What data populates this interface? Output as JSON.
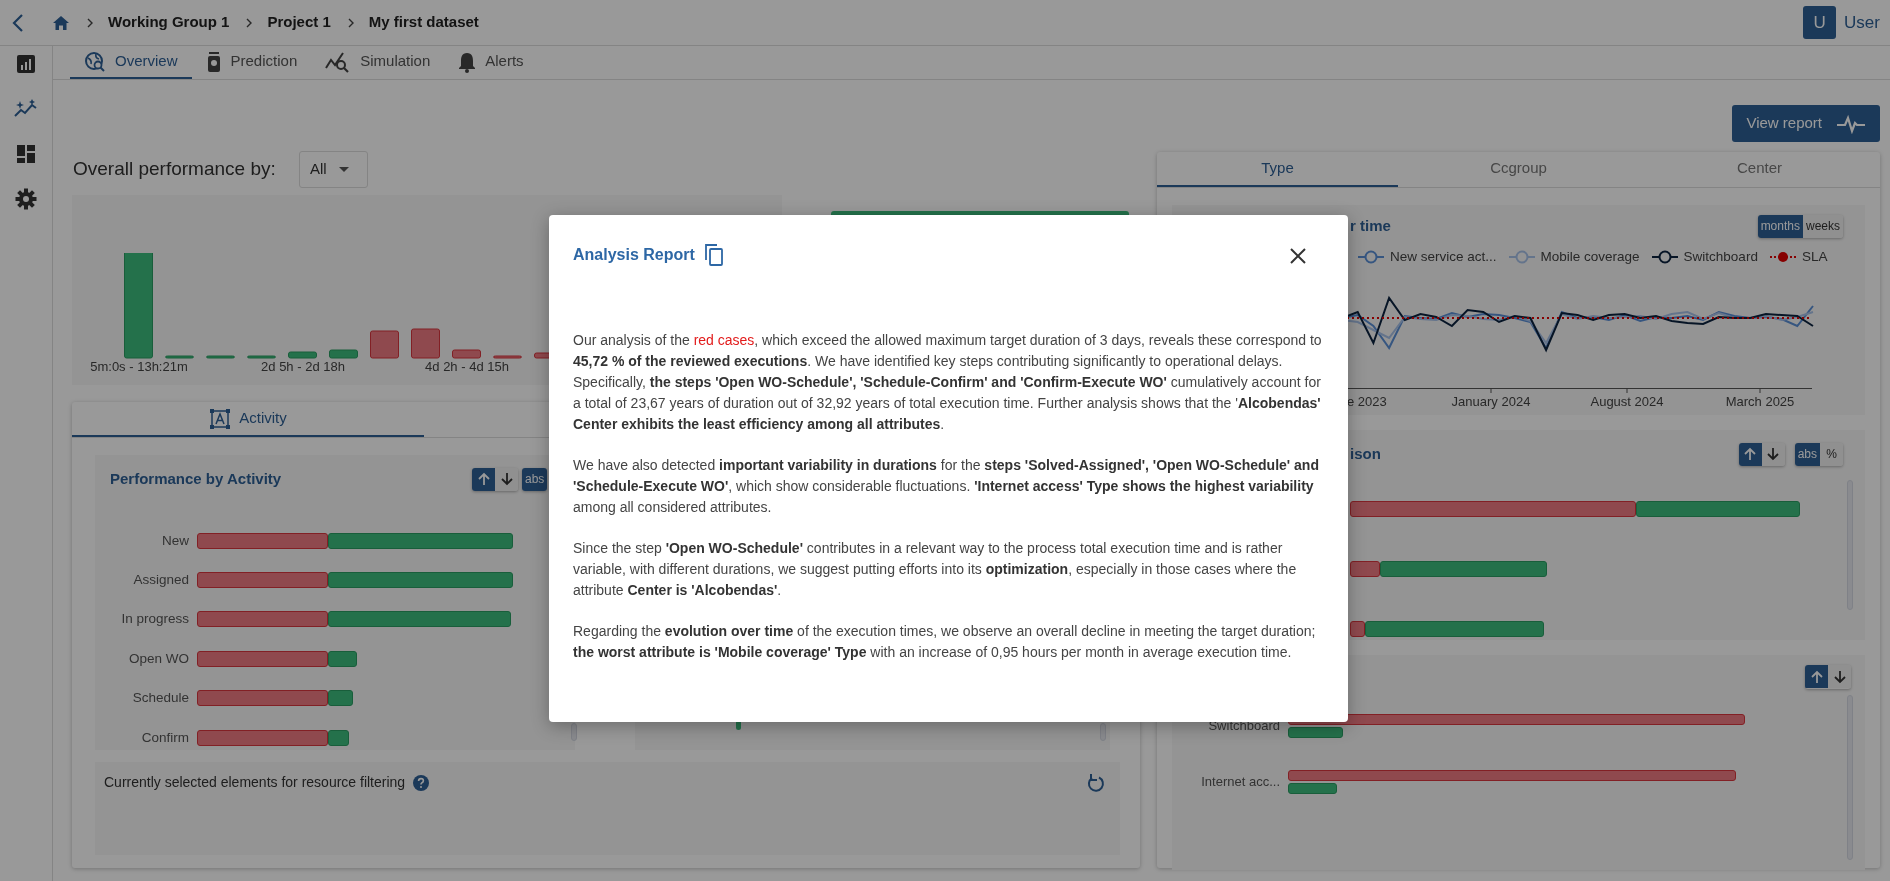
{
  "breadcrumbs": [
    "Working Group 1",
    "Project 1",
    "My first dataset"
  ],
  "user": {
    "initial": "U",
    "name": "User"
  },
  "tabs": [
    {
      "label": "Overview",
      "selected": true
    },
    {
      "label": "Prediction",
      "selected": false
    },
    {
      "label": "Simulation",
      "selected": false
    },
    {
      "label": "Alerts",
      "selected": false
    }
  ],
  "view_report_button": "View report",
  "performance": {
    "label": "Overall performance by:",
    "dropdown": "All"
  },
  "histogram": {
    "x_labels": [
      "5m:0s - 13h:21m",
      "2d 5h - 2d 18h",
      "4d 2h - 4d 15h"
    ]
  },
  "activity_card": {
    "tabs": [
      {
        "label": "Activity",
        "selected": true
      }
    ],
    "panel": {
      "title": "Performance by Activity",
      "sort": [
        {
          "selected": true
        },
        {
          "selected": false
        }
      ],
      "modes": [
        {
          "label": "abs",
          "selected": true
        }
      ],
      "rows": [
        "New",
        "Assigned",
        "In progress",
        "Open WO",
        "Schedule",
        "Confirm"
      ]
    },
    "filter": {
      "label": "Currently selected elements for resource filtering"
    }
  },
  "attribute_card": {
    "tabs": [
      {
        "label": "Type",
        "selected": true
      },
      {
        "label": "Ccgroup",
        "selected": false
      },
      {
        "label": "Center",
        "selected": false
      }
    ],
    "over_time": {
      "title": "r time",
      "units": [
        {
          "label": "months",
          "selected": true
        },
        {
          "label": "weeks",
          "selected": false
        }
      ],
      "legend": [
        {
          "name": "New service act...",
          "kind": "line"
        },
        {
          "name": "Mobile coverage",
          "kind": "line"
        },
        {
          "name": "Switchboard",
          "kind": "line"
        },
        {
          "name": "SLA",
          "kind": "dotted"
        }
      ],
      "x_labels": [
        "e 2023",
        "January 2024",
        "August 2024",
        "March 2025"
      ]
    },
    "comparison": {
      "title": "ison",
      "sort": [
        {
          "selected": true
        },
        {
          "selected": false
        }
      ],
      "modes": [
        {
          "label": "abs",
          "selected": true
        },
        {
          "label": "%",
          "selected": false
        }
      ]
    },
    "breakdown": {
      "sort": [
        {
          "selected": true
        },
        {
          "selected": false
        }
      ],
      "rows": [
        "Switchboard",
        "Internet acc..."
      ]
    }
  },
  "modal": {
    "title": "Analysis Report",
    "paragraphs": [
      [
        {
          "kind": "plain",
          "text": "Our analysis of the "
        },
        {
          "kind": "alert",
          "text": "red cases"
        },
        {
          "kind": "plain",
          "text": ", which exceed the allowed maximum target duration of 3 days, reveals these correspond to "
        },
        {
          "kind": "bold",
          "text": "45,72 % of the reviewed executions"
        },
        {
          "kind": "plain",
          "text": ". We have identified key steps contributing significantly to operational delays. Specifically, "
        },
        {
          "kind": "bold",
          "text": "the steps 'Open WO-Schedule', 'Schedule-Confirm' and 'Confirm-Execute WO'"
        },
        {
          "kind": "plain",
          "text": " cumulatively account for a total of 23,67 years of duration out of 32,92 years of total execution time. Further analysis shows that the '"
        },
        {
          "kind": "bold",
          "text": "Alcobendas' Center exhibits the least efficiency among all attributes"
        },
        {
          "kind": "plain",
          "text": "."
        }
      ],
      [
        {
          "kind": "plain",
          "text": "We have also detected "
        },
        {
          "kind": "bold",
          "text": "important variability in durations"
        },
        {
          "kind": "plain",
          "text": " for the "
        },
        {
          "kind": "bold",
          "text": "steps 'Solved-Assigned', 'Open WO-Schedule' and 'Schedule-Execute WO'"
        },
        {
          "kind": "plain",
          "text": ", which show considerable fluctuations. "
        },
        {
          "kind": "bold",
          "text": "'Internet access' Type shows the highest variability"
        },
        {
          "kind": "plain",
          "text": " among all considered attributes."
        }
      ],
      [
        {
          "kind": "plain",
          "text": "Since the step "
        },
        {
          "kind": "bold",
          "text": "'Open WO-Schedule'"
        },
        {
          "kind": "plain",
          "text": " contributes in a relevant way to the process total execution time and is rather variable, with different durations, we suggest putting efforts into its "
        },
        {
          "kind": "bold",
          "text": "optimization"
        },
        {
          "kind": "plain",
          "text": ", especially in those cases where the attribute "
        },
        {
          "kind": "bold",
          "text": "Center is 'Alcobendas'"
        },
        {
          "kind": "plain",
          "text": "."
        }
      ],
      [
        {
          "kind": "plain",
          "text": "Regarding the "
        },
        {
          "kind": "bold",
          "text": "evolution over time"
        },
        {
          "kind": "plain",
          "text": " of the execution times, we observe an overall decline in meeting the target duration; "
        },
        {
          "kind": "bold",
          "text": "the worst attribute is 'Mobile coverage' Type"
        },
        {
          "kind": "plain",
          "text": " with an increase of 0,95 hours per month in average execution time."
        }
      ]
    ]
  }
}
